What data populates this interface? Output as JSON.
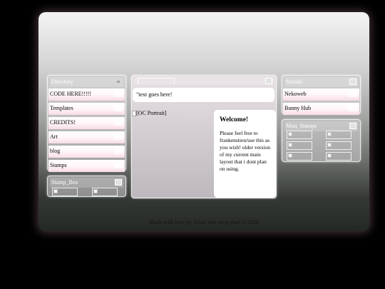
{
  "directory": {
    "title": "Directory",
    "items": [
      {
        "label": "CODE HERE!!!!!"
      },
      {
        "label": "Templates"
      },
      {
        "label": "CREDITS!"
      },
      {
        "label": "Art"
      },
      {
        "label": "blog"
      },
      {
        "label": "Stamps"
      }
    ]
  },
  "stamp_box": {
    "title": "Stamp_Box"
  },
  "main": {
    "title": "",
    "intro_text": "\"text goes here!",
    "portrait_alt": "[OC Portrait]",
    "welcome": {
      "heading": "Welcome!",
      "body": "Please feel free to frankenstien/use this as you wish! older version of my current main layout that i dont plan on using."
    }
  },
  "socials": {
    "title": "Socials",
    "items": [
      {
        "label": "Nekoweb"
      },
      {
        "label": "Bunny Hub"
      }
    ]
  },
  "mini_stamps": {
    "title": "Mini_Stamps"
  },
  "footer": {
    "text": "Made with love by Zena! and soon you! © 2026"
  }
}
